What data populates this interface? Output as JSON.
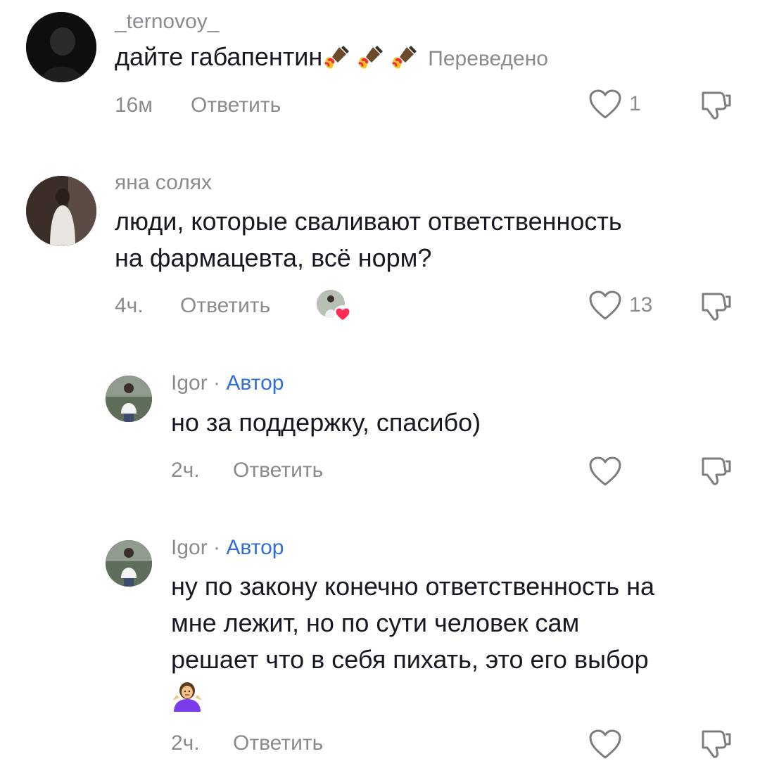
{
  "comments": [
    {
      "username": "_ternovoy_",
      "text": "дайте габапентин",
      "translated_label": "Переведено",
      "time": "16м",
      "reply_label": "Ответить",
      "likes": "1"
    },
    {
      "username": "яна солях",
      "text_line1": "люди, которые сваливают ответственность",
      "text_line2": "на фармацевта, всё норм?",
      "time": "4ч.",
      "reply_label": "Ответить",
      "likes": "13"
    },
    {
      "username": "Igor",
      "dot": "·",
      "author_label": "Автор",
      "text": "но за поддержку, спасибо)",
      "time": "2ч.",
      "reply_label": "Ответить"
    },
    {
      "username": "Igor",
      "dot": "·",
      "author_label": "Автор",
      "text_line1": "ну по закону конечно ответственность на",
      "text_line2": "мне лежит, но по сути человек сам",
      "text_line3": "решает что в себя пихать, это его выбор",
      "time": "2ч.",
      "reply_label": "Ответить"
    }
  ],
  "icons": {
    "like": "heart-outline-icon",
    "dislike": "thumbs-down-icon",
    "emoji_nail_polish": "nail-polish-emoji",
    "emoji_shrug": "woman-shrugging-emoji"
  },
  "colors": {
    "author_badge": "#2f6fd6",
    "secondary_text": "#8a8b91",
    "primary_text": "#161823",
    "liked_heart": "#fe2c55"
  }
}
